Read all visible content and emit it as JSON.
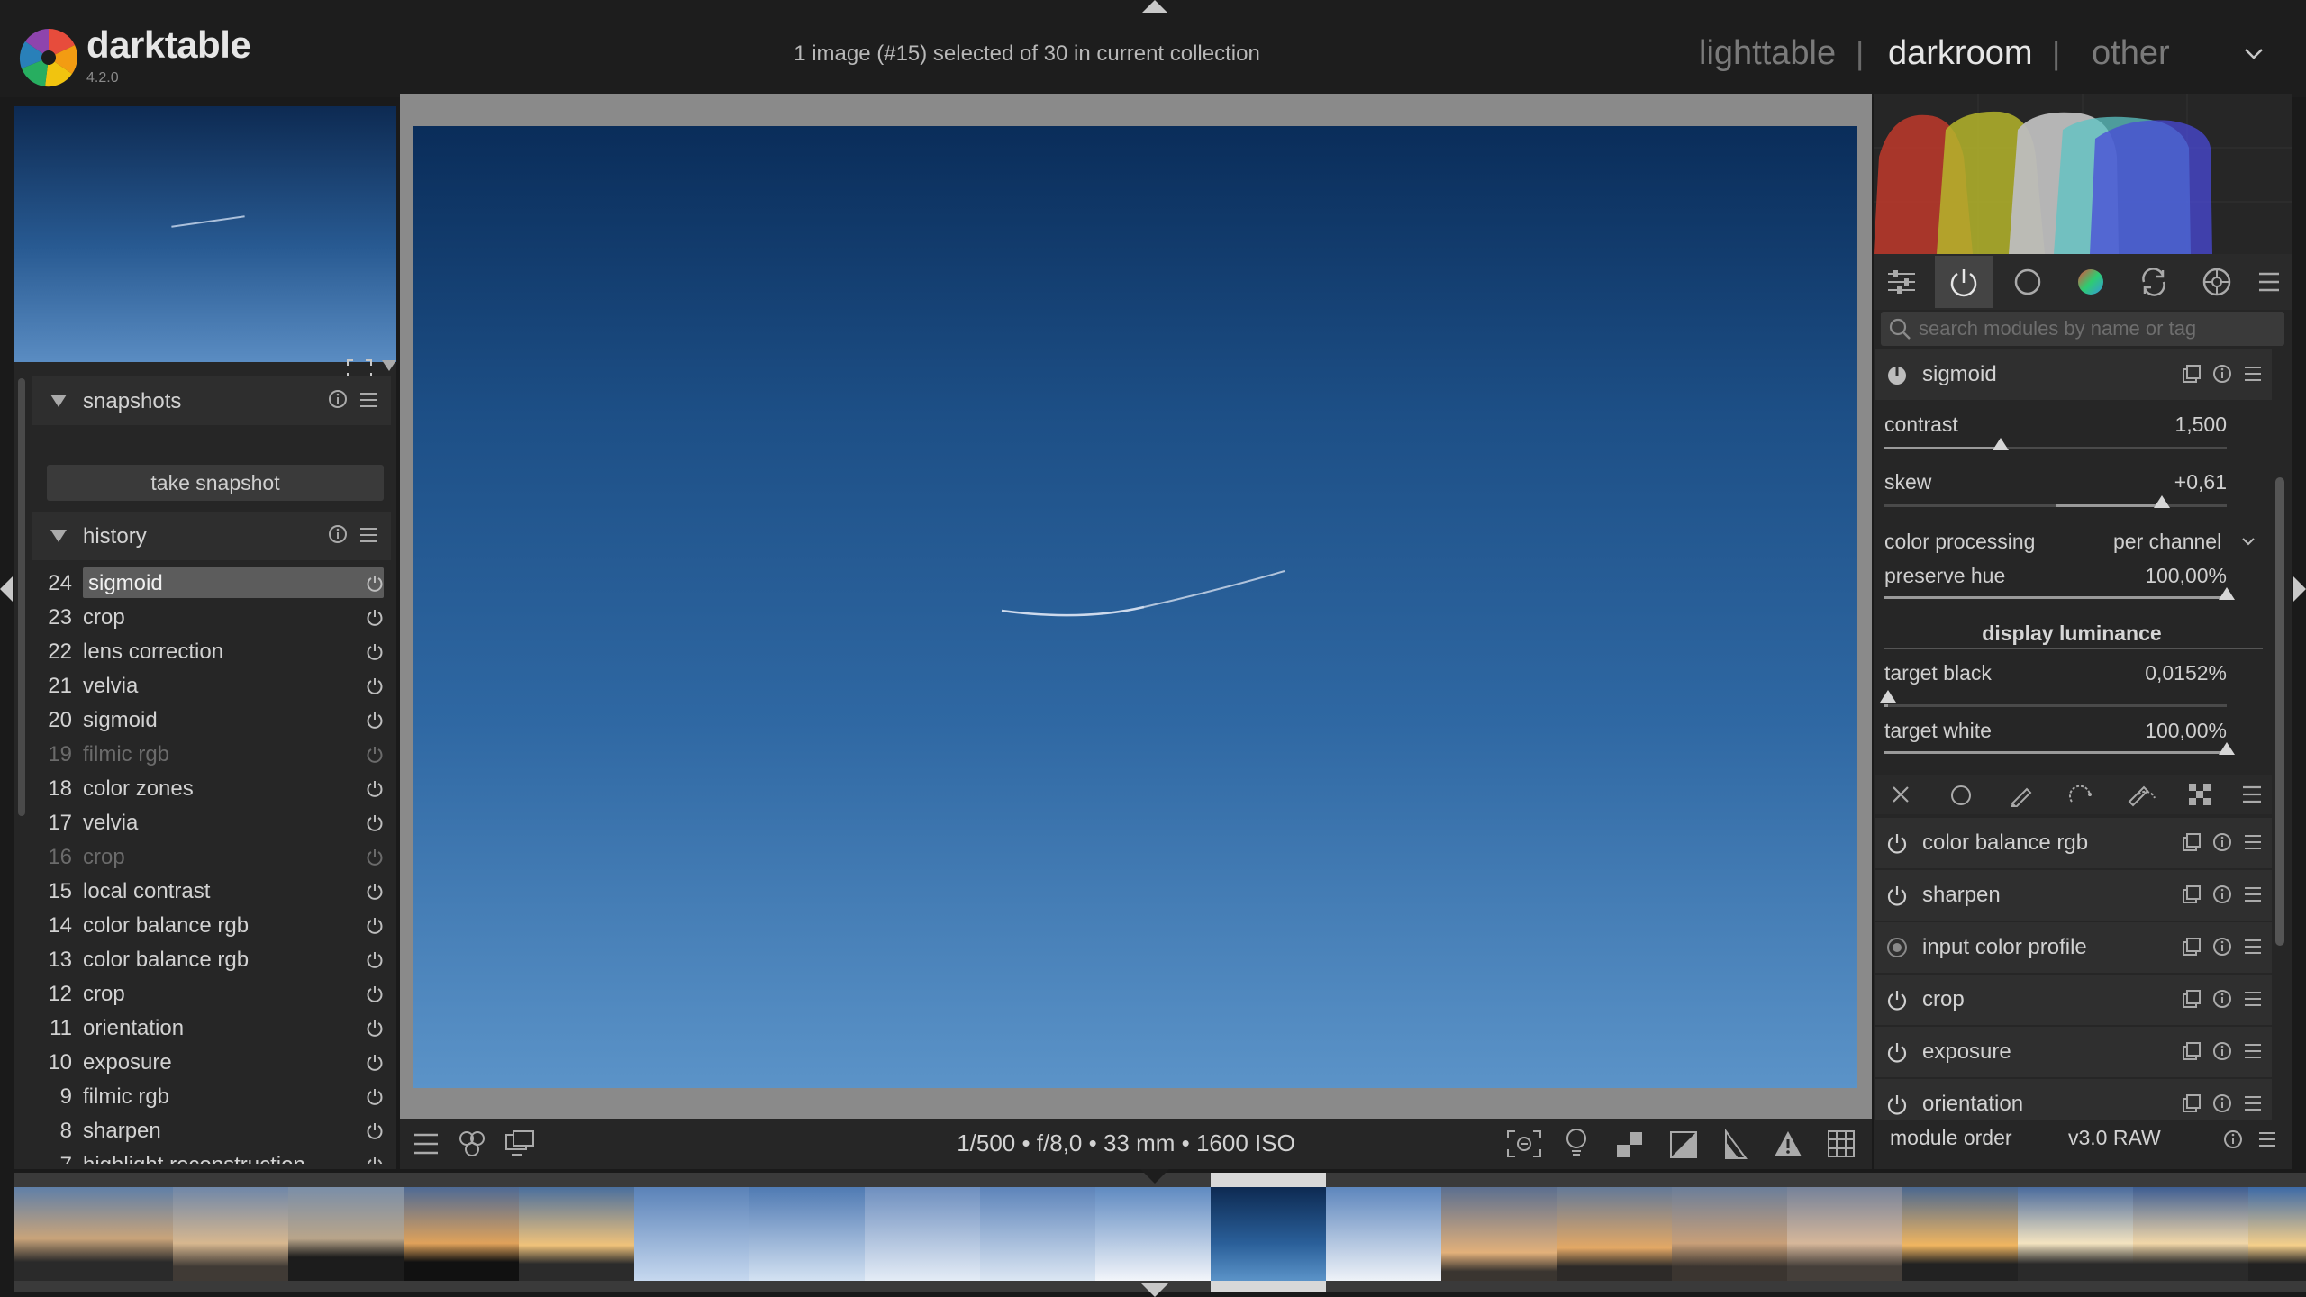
{
  "app": {
    "name": "darktable",
    "version": "4.2.0"
  },
  "topbar": {
    "status": "1 image (#15) selected of 30 in current collection",
    "views": {
      "lighttable": "lighttable",
      "darkroom": "darkroom",
      "other": "other",
      "separator": "|"
    }
  },
  "left": {
    "snapshots": {
      "title": "snapshots",
      "button": "take snapshot"
    },
    "history": {
      "title": "history",
      "items": [
        {
          "num": "24",
          "name": "sigmoid",
          "selected": true
        },
        {
          "num": "23",
          "name": "crop"
        },
        {
          "num": "22",
          "name": "lens correction"
        },
        {
          "num": "21",
          "name": "velvia"
        },
        {
          "num": "20",
          "name": "sigmoid"
        },
        {
          "num": "19",
          "name": "filmic rgb",
          "dim": true
        },
        {
          "num": "18",
          "name": "color zones"
        },
        {
          "num": "17",
          "name": "velvia"
        },
        {
          "num": "16",
          "name": "crop",
          "dim": true
        },
        {
          "num": "15",
          "name": "local contrast"
        },
        {
          "num": "14",
          "name": "color balance rgb"
        },
        {
          "num": "13",
          "name": "color balance rgb"
        },
        {
          "num": "12",
          "name": "crop"
        },
        {
          "num": "11",
          "name": "orientation"
        },
        {
          "num": "10",
          "name": "exposure"
        },
        {
          "num": "9",
          "name": "filmic rgb"
        },
        {
          "num": "8",
          "name": "sharpen"
        },
        {
          "num": "7",
          "name": "highlight reconstruction"
        }
      ]
    }
  },
  "center": {
    "exif": "1/500 • f/8,0 • 33 mm • 1600 ISO"
  },
  "right": {
    "search_placeholder": "search modules by name or tag",
    "sigmoid": {
      "title": "sigmoid",
      "contrast": {
        "label": "contrast",
        "value": "1,500",
        "fraction": 0.34
      },
      "skew": {
        "label": "skew",
        "value": "+0,61",
        "fraction": 0.81
      },
      "color_processing": {
        "label": "color processing",
        "value": "per channel"
      },
      "preserve_hue": {
        "label": "preserve hue",
        "value": "100,00%",
        "fraction": 1.0
      },
      "display_luminance": "display luminance",
      "target_black": {
        "label": "target black",
        "value": "0,0152%",
        "fraction": 0.01
      },
      "target_white": {
        "label": "target white",
        "value": "100,00%",
        "fraction": 1.0
      }
    },
    "modules": [
      {
        "name": "color balance rgb"
      },
      {
        "name": "sharpen"
      },
      {
        "name": "input color profile"
      },
      {
        "name": "crop"
      },
      {
        "name": "exposure"
      },
      {
        "name": "orientation"
      }
    ],
    "module_order": {
      "label": "module order",
      "value": "v3.0 RAW"
    }
  },
  "colors": {
    "accent": "#5c5c5c",
    "histogram_red": "#c0392b",
    "histogram_green": "#b5b52c",
    "histogram_blue": "#4a4ad8",
    "histogram_cyan": "#5cc4c4"
  }
}
